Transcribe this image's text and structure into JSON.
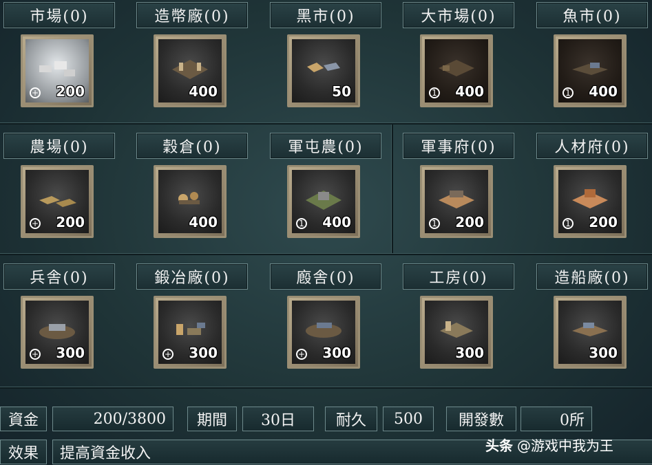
{
  "buildings": [
    {
      "id": "market",
      "label": "市場(0)",
      "cost": "200",
      "mark": "+",
      "state": "lit"
    },
    {
      "id": "mint",
      "label": "造幣廠(0)",
      "cost": "400",
      "mark": "",
      "state": "normal"
    },
    {
      "id": "black-market",
      "label": "黑市(0)",
      "cost": "50",
      "mark": "",
      "state": "normal"
    },
    {
      "id": "grand-market",
      "label": "大市場(0)",
      "cost": "400",
      "mark": "1",
      "state": "dim"
    },
    {
      "id": "fish-market",
      "label": "魚市(0)",
      "cost": "400",
      "mark": "1",
      "state": "dim"
    },
    {
      "id": "farm",
      "label": "農場(0)",
      "cost": "200",
      "mark": "+",
      "state": "normal"
    },
    {
      "id": "granary",
      "label": "穀倉(0)",
      "cost": "400",
      "mark": "",
      "state": "normal"
    },
    {
      "id": "military-farm",
      "label": "軍屯農(0)",
      "cost": "400",
      "mark": "1",
      "state": "normal"
    },
    {
      "id": "military-office",
      "label": "軍事府(0)",
      "cost": "200",
      "mark": "1",
      "state": "normal"
    },
    {
      "id": "talent-office",
      "label": "人材府(0)",
      "cost": "200",
      "mark": "1",
      "state": "normal"
    },
    {
      "id": "barracks",
      "label": "兵舎(0)",
      "cost": "300",
      "mark": "+",
      "state": "normal"
    },
    {
      "id": "forge",
      "label": "鍛冶廠(0)",
      "cost": "300",
      "mark": "+",
      "state": "normal"
    },
    {
      "id": "stable",
      "label": "廏舎(0)",
      "cost": "300",
      "mark": "+",
      "state": "normal"
    },
    {
      "id": "workshop",
      "label": "工房(0)",
      "cost": "300",
      "mark": "",
      "state": "normal"
    },
    {
      "id": "shipyard",
      "label": "造船廠(0)",
      "cost": "300",
      "mark": "",
      "state": "normal"
    }
  ],
  "stats": {
    "funds_label": "資金",
    "funds_value": "200/3800",
    "period_label": "期間",
    "period_value": "30日",
    "durability_label": "耐久",
    "durability_value": "500",
    "dev_label": "開發數",
    "dev_value": "0所",
    "effect_label": "效果",
    "effect_value": "提高資金收入"
  },
  "watermark": {
    "brand": "头条",
    "handle": "@游戏中我为王"
  },
  "colors": {
    "tile_border": "#9a8e74",
    "panel_bg": "#1f3437"
  },
  "icons": {
    "plus": "circle-plus-icon",
    "one": "circle-one-icon"
  }
}
